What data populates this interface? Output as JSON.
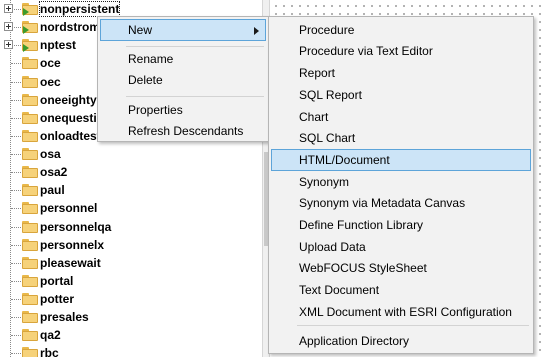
{
  "tree": {
    "items": [
      {
        "label": "nonpersistent",
        "expandable": true,
        "icon": "folder-arrow-icon",
        "focused": true
      },
      {
        "label": "nordstrom",
        "expandable": true,
        "icon": "folder-arrow-icon"
      },
      {
        "label": "nptest",
        "expandable": true,
        "icon": "folder-arrow-icon"
      },
      {
        "label": "oce",
        "icon": "folder-icon"
      },
      {
        "label": "oec",
        "icon": "folder-icon"
      },
      {
        "label": "oneeighty",
        "icon": "folder-icon"
      },
      {
        "label": "onequestion",
        "icon": "folder-icon"
      },
      {
        "label": "onloadtest",
        "icon": "folder-icon"
      },
      {
        "label": "osa",
        "icon": "folder-icon"
      },
      {
        "label": "osa2",
        "icon": "folder-icon"
      },
      {
        "label": "paul",
        "icon": "folder-icon"
      },
      {
        "label": "personnel",
        "icon": "folder-icon"
      },
      {
        "label": "personnelqa",
        "icon": "folder-icon"
      },
      {
        "label": "personnelx",
        "icon": "folder-icon"
      },
      {
        "label": "pleasewait",
        "icon": "folder-icon"
      },
      {
        "label": "portal",
        "icon": "folder-icon"
      },
      {
        "label": "potter",
        "icon": "folder-icon"
      },
      {
        "label": "presales",
        "icon": "folder-icon"
      },
      {
        "label": "qa2",
        "icon": "folder-icon"
      },
      {
        "label": "rbc",
        "icon": "folder-icon"
      }
    ]
  },
  "context_menu": {
    "items": [
      "New",
      "Rename",
      "Delete",
      "Properties",
      "Refresh Descendants"
    ],
    "submenu_icon": "chevron-right-icon"
  },
  "new_submenu": {
    "items": [
      "Procedure",
      "Procedure via Text Editor",
      "Report",
      "SQL Report",
      "Chart",
      "SQL Chart",
      "HTML/Document",
      "Synonym",
      "Synonym via Metadata Canvas",
      "Define Function Library",
      "Upload Data",
      "WebFOCUS StyleSheet",
      "Text Document",
      "XML Document with ESRI Configuration",
      "Application Directory"
    ],
    "highlighted": "HTML/Document"
  },
  "colors": {
    "menu_bg": "#f2f2f2",
    "highlight_bg": "#cce4f7",
    "highlight_border": "#5da4d9",
    "folder": "#f6d27a",
    "arrow": "#3c9b2c"
  }
}
